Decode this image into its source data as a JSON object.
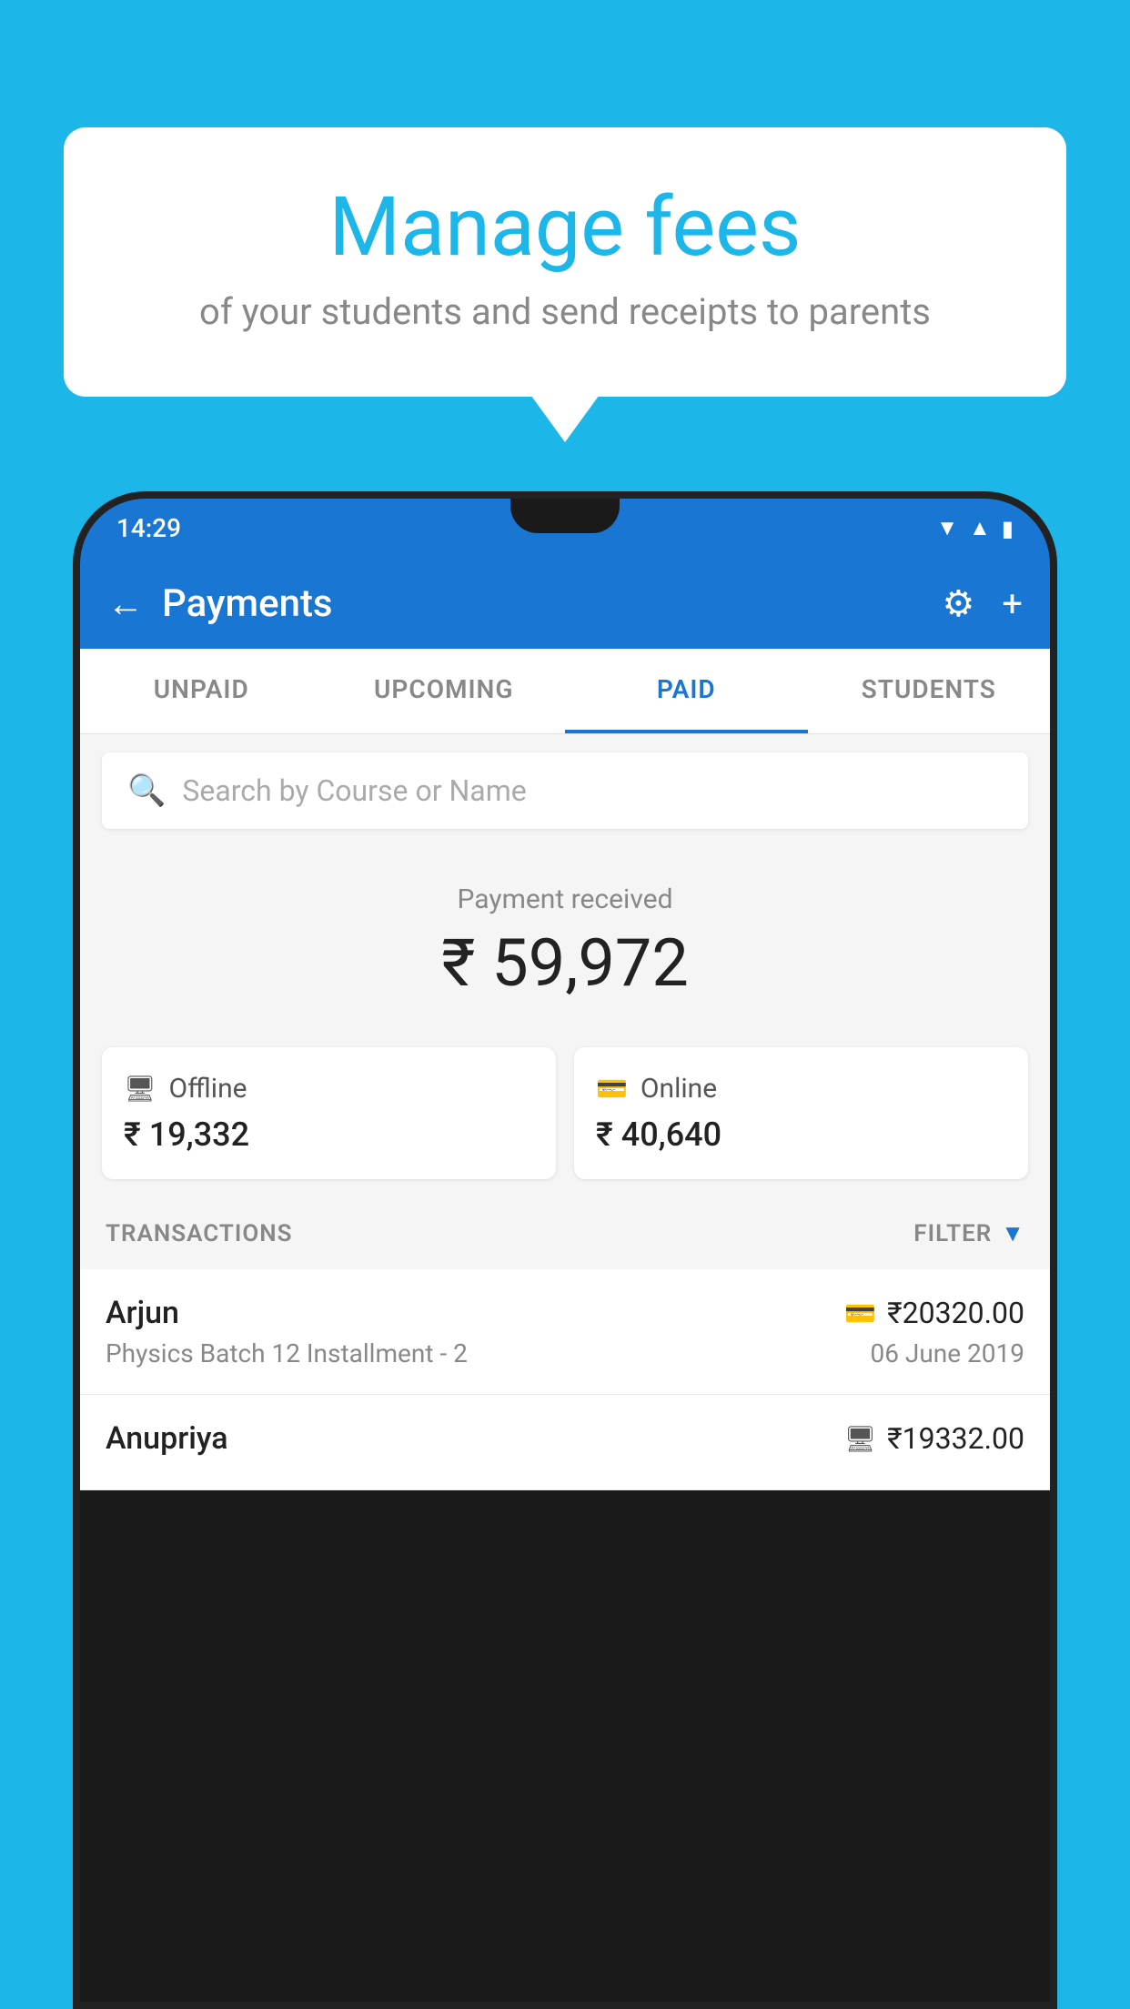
{
  "background_color": "#1db6e8",
  "bubble": {
    "title": "Manage fees",
    "subtitle": "of your students and send receipts to parents"
  },
  "status_bar": {
    "time": "14:29"
  },
  "app_bar": {
    "title": "Payments"
  },
  "tabs": [
    {
      "label": "UNPAID",
      "active": false
    },
    {
      "label": "UPCOMING",
      "active": false
    },
    {
      "label": "PAID",
      "active": true
    },
    {
      "label": "STUDENTS",
      "active": false
    }
  ],
  "search": {
    "placeholder": "Search by Course or Name"
  },
  "payment_summary": {
    "label": "Payment received",
    "amount": "₹ 59,972"
  },
  "payment_cards": [
    {
      "icon": "offline",
      "label": "Offline",
      "amount": "₹ 19,332"
    },
    {
      "icon": "online",
      "label": "Online",
      "amount": "₹ 40,640"
    }
  ],
  "transactions_section": {
    "label": "TRANSACTIONS",
    "filter_label": "FILTER"
  },
  "transactions": [
    {
      "name": "Arjun",
      "course": "Physics Batch 12 Installment - 2",
      "amount": "₹20320.00",
      "date": "06 June 2019",
      "payment_type": "online"
    },
    {
      "name": "Anupriya",
      "course": "",
      "amount": "₹19332.00",
      "date": "",
      "payment_type": "offline"
    }
  ]
}
